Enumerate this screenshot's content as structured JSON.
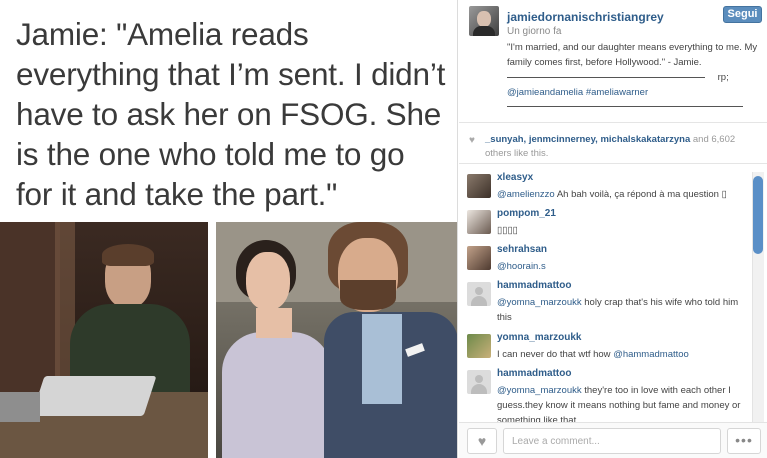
{
  "media": {
    "quote_text": "Jamie: \"Amelia reads everything that I’m sent. I didn’t have to ask her on FSOG. She is the one who told me to go for it and take the part.\""
  },
  "post": {
    "username": "jamiedornanischristiangrey",
    "follow_label": "Segui",
    "time": "Un giorno fa",
    "caption_quote": "\"I'm married, and our daughter means everything to me. My family comes first, before Hollywood.\" - Jamie.",
    "caption_rp": "rp;",
    "caption_tags": "@jamieandamelia #ameliawarner"
  },
  "likes": {
    "names": "_sunyah, jenmcinnerney, michalskakatarzyna",
    "suffix": "and 6,602 others like this."
  },
  "comments": [
    {
      "user": "xleasyx",
      "mention": "@amelienzzo",
      "text": " Ah bah voilà, ça répond à ma question ▯"
    },
    {
      "user": "pompom_21",
      "mention": "",
      "text": "▯▯▯▯"
    },
    {
      "user": "sehrahsan",
      "mention": "@hoorain.s",
      "text": ""
    },
    {
      "user": "hammadmattoo",
      "mention": "@yomna_marzoukk",
      "text": " holy crap that's his wife who told him this"
    },
    {
      "user": "yomna_marzoukk",
      "mention": "@hammadmattoo",
      "text": "I can never do that wtf how "
    },
    {
      "user": "hammadmattoo",
      "mention": "@yomna_marzoukk",
      "text": " they're too in love with each other I guess.they know it means nothing but fame and money or something like that"
    }
  ],
  "footer": {
    "comment_placeholder": "Leave a comment...",
    "more_label": "•••"
  },
  "icons": {
    "heart": "heart-icon",
    "more": "more-options-icon"
  },
  "colors": {
    "link": "#2f5d8a",
    "follow_button": "#5b8dbd",
    "scrollbar": "#5a8fc7"
  }
}
